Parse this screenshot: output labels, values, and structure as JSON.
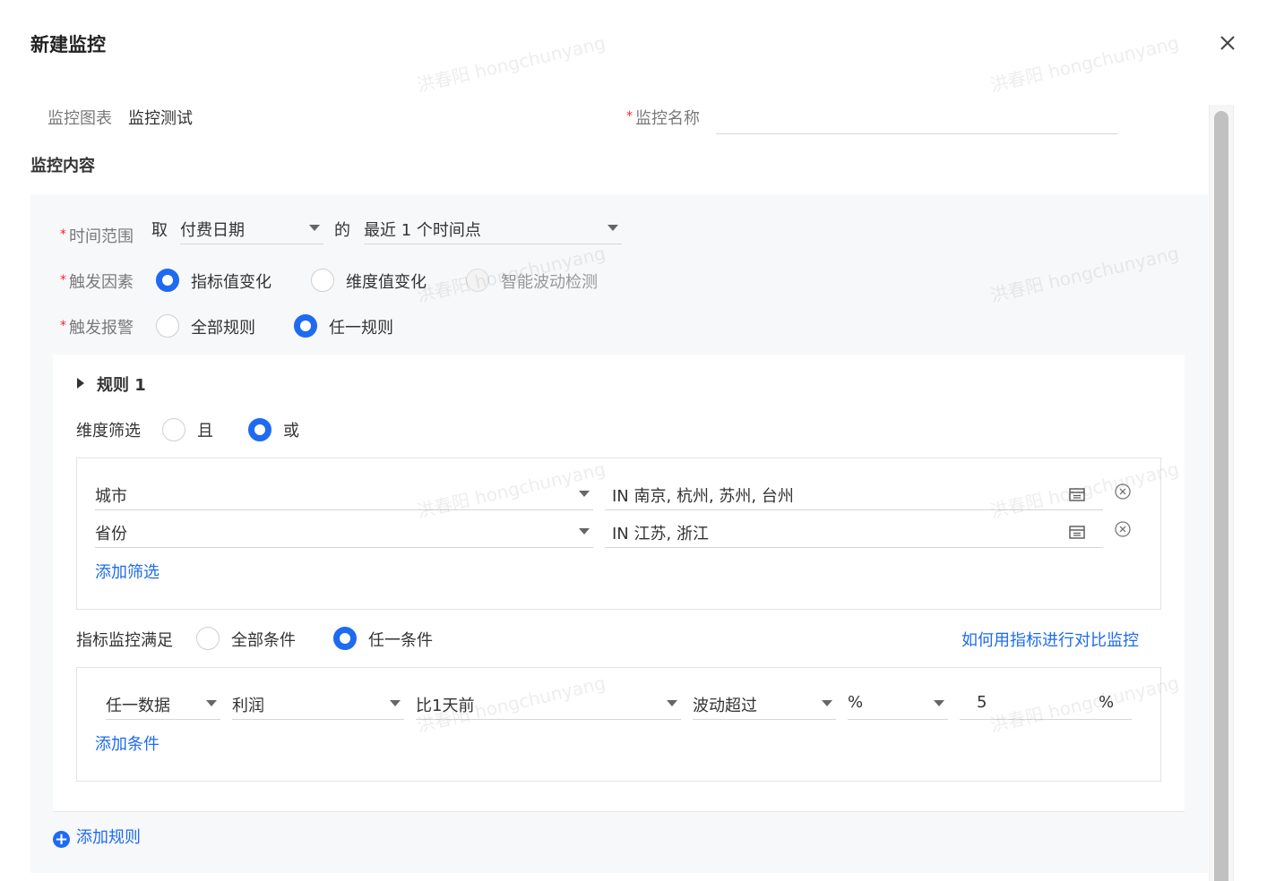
{
  "dialog": {
    "title": "新建监控"
  },
  "header_fields": {
    "chart_label": "监控图表",
    "chart_value": "监控测试",
    "name_label": "监控名称",
    "name_value": "",
    "required_mark": "*"
  },
  "content": {
    "section_title": "监控内容",
    "time_range": {
      "label": "时间范围",
      "take_text": "取",
      "date_field": "付费日期",
      "of_text": "的",
      "period": "最近 1 个时间点"
    },
    "trigger_factor": {
      "label": "触发因素",
      "options": [
        {
          "label": "指标值变化",
          "selected": true,
          "disabled": false
        },
        {
          "label": "维度值变化",
          "selected": false,
          "disabled": false
        },
        {
          "label": "智能波动检测",
          "selected": false,
          "disabled": true
        }
      ]
    },
    "trigger_alert": {
      "label": "触发报警",
      "options": [
        {
          "label": "全部规则",
          "selected": false
        },
        {
          "label": "任一规则",
          "selected": true
        }
      ]
    },
    "rule": {
      "title": "规则 1",
      "dimension_filter": {
        "label": "维度筛选",
        "options": [
          {
            "label": "且",
            "selected": false
          },
          {
            "label": "或",
            "selected": true
          }
        ],
        "rows": [
          {
            "dimension": "城市",
            "values": "IN 南京, 杭州, 苏州, 台州"
          },
          {
            "dimension": "省份",
            "values": "IN 江苏, 浙江"
          }
        ],
        "add_link": "添加筛选"
      },
      "metric_condition": {
        "label": "指标监控满足",
        "options": [
          {
            "label": "全部条件",
            "selected": false
          },
          {
            "label": "任一条件",
            "selected": true
          }
        ],
        "help_link": "如何用指标进行对比监控",
        "row": {
          "scope": "任一数据",
          "metric": "利润",
          "compare": "比1天前",
          "operator": "波动超过",
          "unit_type": "%",
          "threshold": "5",
          "threshold_unit": "%"
        },
        "add_link": "添加条件"
      }
    },
    "add_rule": "添加规则"
  },
  "watermark": "洪春阳 hongchunyang",
  "colors": {
    "accent": "#1e6bf1",
    "required": "#f5222d",
    "panel_bg": "#f7f8fa"
  }
}
